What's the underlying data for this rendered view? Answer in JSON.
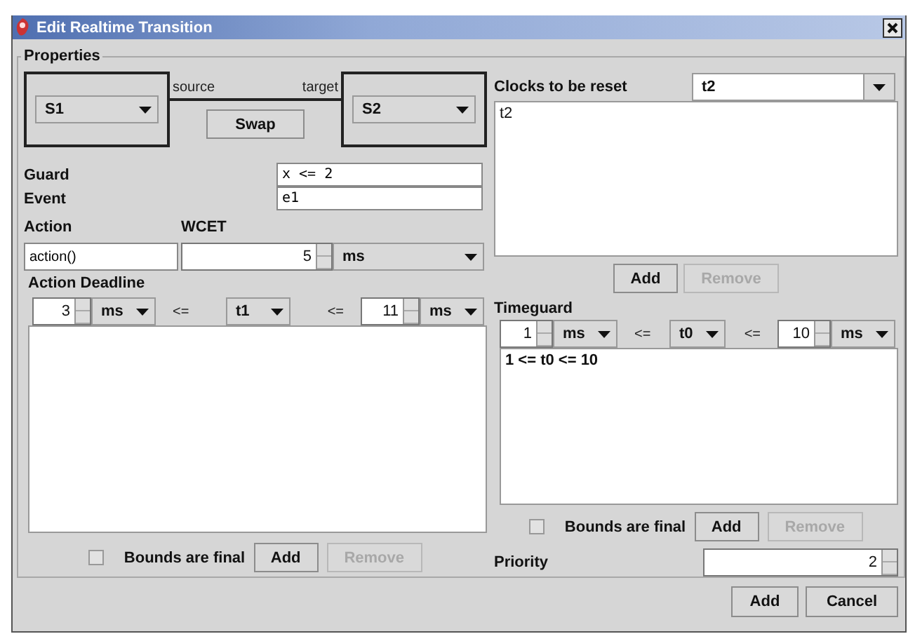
{
  "window": {
    "title": "Edit Realtime Transition"
  },
  "properties": {
    "title": "Properties",
    "source": {
      "label": "source",
      "value": "S1"
    },
    "target": {
      "label": "target",
      "value": "S2"
    },
    "swap_button": "Swap",
    "guard": {
      "label": "Guard",
      "value": "x <= 2"
    },
    "event": {
      "label": "Event",
      "value": "e1"
    },
    "action": {
      "label": "Action",
      "value": "action()"
    },
    "wcet": {
      "label": "WCET",
      "value": "5",
      "unit": "ms"
    },
    "action_deadline": {
      "title": "Action Deadline",
      "lower": "3",
      "lower_unit": "ms",
      "op1": "<=",
      "clock": "t1",
      "op2": "<=",
      "upper": "11",
      "upper_unit": "ms",
      "bounds_final": {
        "label": "Bounds are final",
        "checked": false
      },
      "buttons": [
        {
          "label": "Add",
          "disabled": false
        },
        {
          "label": "Remove",
          "disabled": true
        }
      ]
    },
    "clocks_reset": {
      "label": "Clocks to be reset",
      "value": "t2",
      "items": [
        "t2"
      ],
      "buttons": [
        {
          "label": "Add",
          "disabled": false
        },
        {
          "label": "Remove",
          "disabled": true
        }
      ]
    },
    "timeguard": {
      "title": "Timeguard",
      "lower": "1",
      "lower_unit": "ms",
      "op1": "<=",
      "clock": "t0",
      "op2": "<=",
      "upper": "10",
      "upper_unit": "ms",
      "items": [
        "1 <= t0 <= 10"
      ],
      "bounds_final": {
        "label": "Bounds are final",
        "checked": false
      },
      "buttons": [
        {
          "label": "Add",
          "disabled": false
        },
        {
          "label": "Remove",
          "disabled": true
        }
      ]
    },
    "priority": {
      "label": "Priority",
      "value": "2"
    }
  },
  "buttons": [
    {
      "label": "Add",
      "disabled": false
    },
    {
      "label": "Cancel",
      "disabled": false
    }
  ]
}
